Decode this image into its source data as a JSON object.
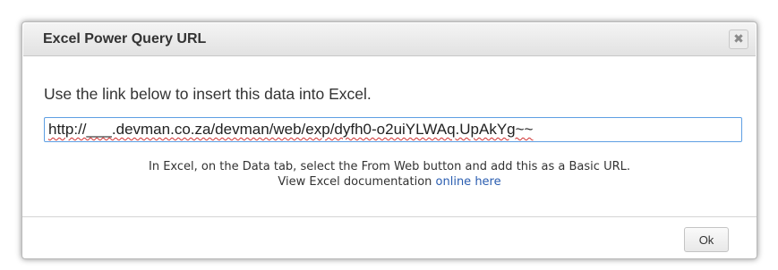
{
  "dialog": {
    "title": "Excel Power Query URL",
    "close_icon": "close-icon",
    "close_glyph": "✖",
    "intro_text": "Use the link below to insert this data into Excel.",
    "url_value": "http://___.devman.co.za/devman/web/exp/dyfh0-o2uiYLWAq.UpAkYg~~",
    "help_text": "In Excel, on the Data tab, select the From Web button and add this as a Basic URL.",
    "doc_text": "View Excel documentation",
    "doc_link_text": "online here",
    "ok_label": "Ok"
  },
  "colors": {
    "input_border": "#5e9fe3",
    "link": "#2a5db0",
    "spellcheck_underline": "#d03030"
  }
}
